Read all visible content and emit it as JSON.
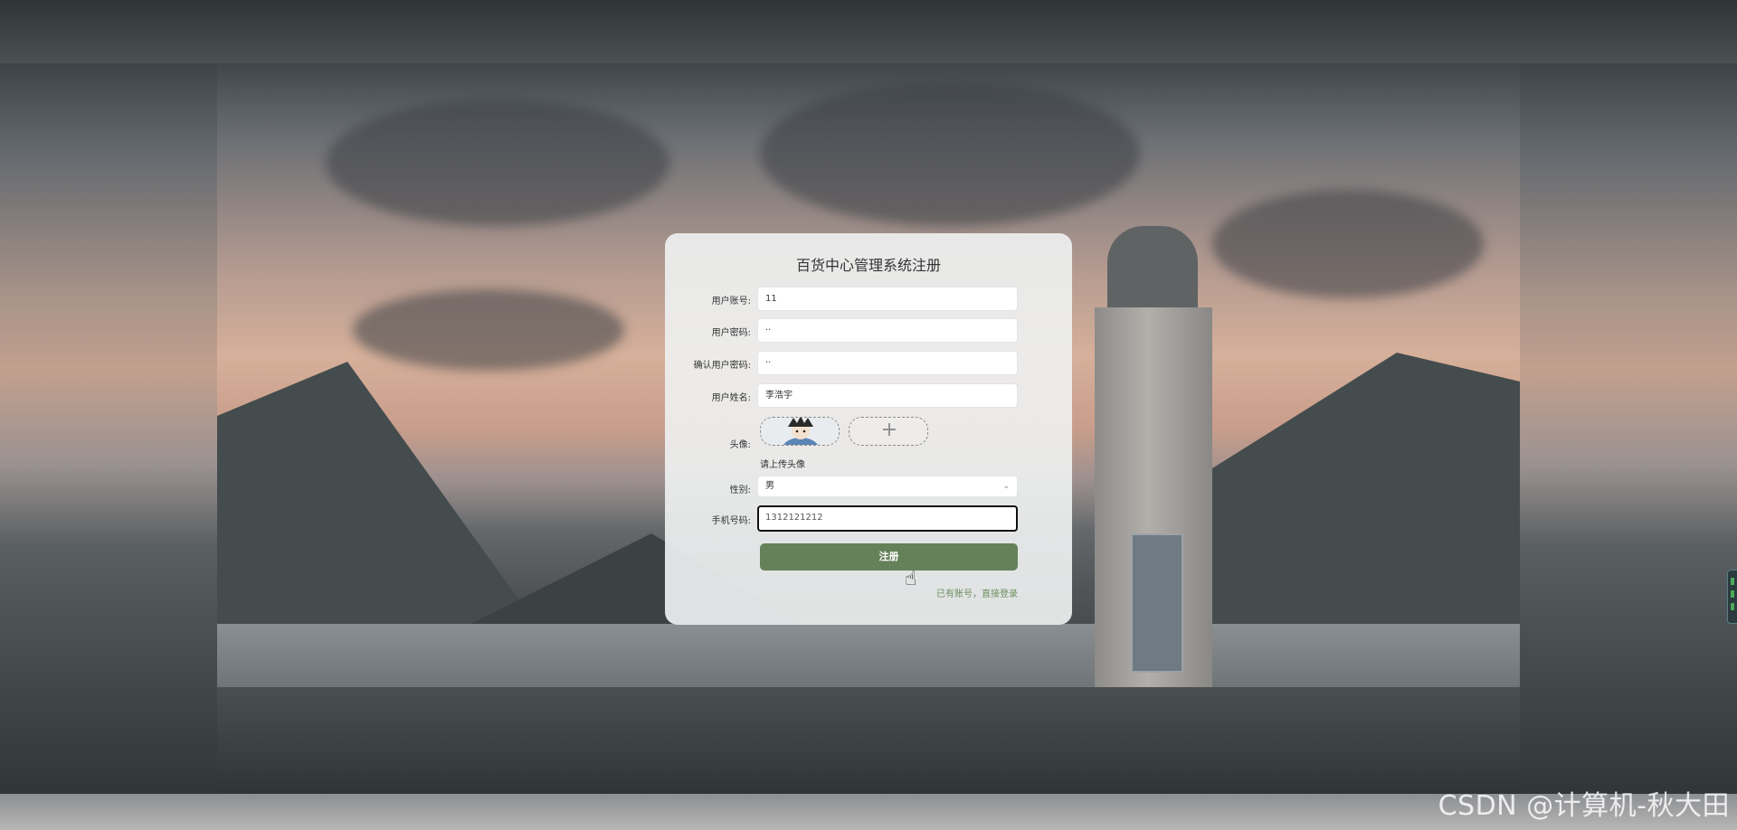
{
  "form": {
    "title": "百货中心管理系统注册",
    "fields": [
      {
        "label": "用户账号:",
        "value": "11"
      },
      {
        "label": "用户密码:",
        "value": "··"
      },
      {
        "label": "确认用户密码:",
        "value": "··"
      },
      {
        "label": "用户姓名:",
        "value": "李浩宇"
      }
    ],
    "avatar": {
      "label": "头像:",
      "hint": "请上传头像",
      "add_icon": "plus-icon"
    },
    "gender": {
      "label": "性别:",
      "value": "男",
      "arrow_icon": "chevron-down-icon"
    },
    "phone": {
      "label": "手机号码:",
      "value": "1312121212"
    },
    "submit_label": "注册",
    "login_link": "已有账号，直接登录"
  },
  "watermark": "CSDN @计算机-秋大田",
  "colors": {
    "primary_button": "#65815a",
    "link": "#6c8f5f",
    "card_bg": "#eef0f0"
  }
}
